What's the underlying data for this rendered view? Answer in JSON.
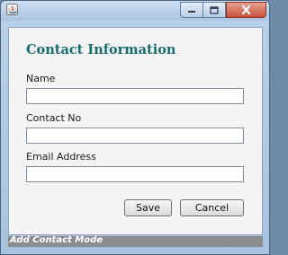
{
  "window": {
    "title": "",
    "controls": {
      "minimize_icon": "minimize-icon",
      "maximize_icon": "maximize-icon",
      "close_icon": "close-icon"
    }
  },
  "form": {
    "heading": "Contact Information",
    "fields": [
      {
        "label": "Name",
        "value": "",
        "placeholder": ""
      },
      {
        "label": "Contact No",
        "value": "",
        "placeholder": ""
      },
      {
        "label": "Email Address",
        "value": "",
        "placeholder": ""
      }
    ],
    "save_label": "Save",
    "cancel_label": "Cancel"
  },
  "status": {
    "text": "Add Contact Mode"
  },
  "colors": {
    "heading": "#176b6e",
    "status_bar": "#8c8c8c",
    "close_button": "#c7533b"
  }
}
